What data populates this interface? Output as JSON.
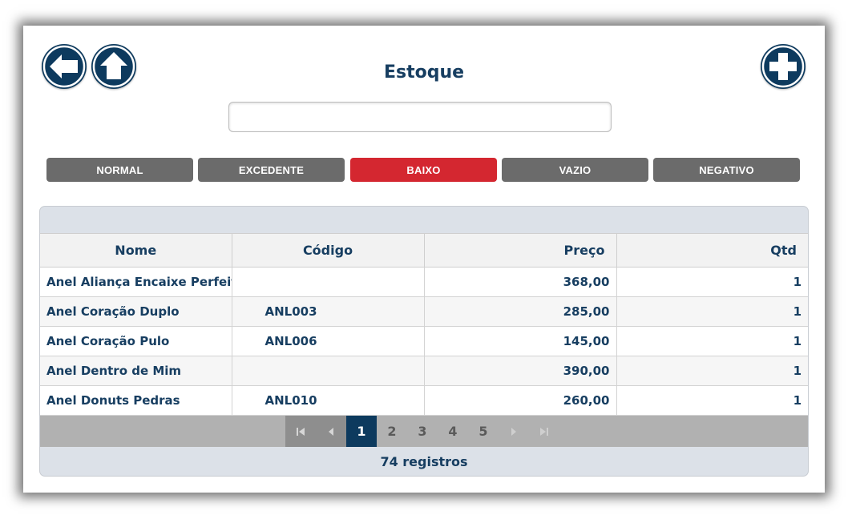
{
  "header": {
    "title": "Estoque",
    "back_icon": "arrow-left-icon",
    "home_icon": "arrow-up-icon",
    "add_icon": "plus-icon"
  },
  "search": {
    "value": "",
    "placeholder": ""
  },
  "filters": [
    {
      "label": "NORMAL",
      "active": false
    },
    {
      "label": "EXCEDENTE",
      "active": false
    },
    {
      "label": "BAIXO",
      "active": true
    },
    {
      "label": "VAZIO",
      "active": false
    },
    {
      "label": "NEGATIVO",
      "active": false
    }
  ],
  "table": {
    "columns": [
      "Nome",
      "Código",
      "Preço",
      "Qtd"
    ],
    "rows": [
      {
        "nome": "Anel Aliança Encaixe Perfeito",
        "codigo": "",
        "preco": "368,00",
        "qtd": "1"
      },
      {
        "nome": "Anel Coração Duplo",
        "codigo": "ANL003",
        "preco": "285,00",
        "qtd": "1"
      },
      {
        "nome": "Anel Coração Pulo",
        "codigo": "ANL006",
        "preco": "145,00",
        "qtd": "1"
      },
      {
        "nome": "Anel Dentro de Mim",
        "codigo": "",
        "preco": "390,00",
        "qtd": "1"
      },
      {
        "nome": "Anel Donuts Pedras",
        "codigo": "ANL010",
        "preco": "260,00",
        "qtd": "1"
      }
    ]
  },
  "pager": {
    "pages": [
      "1",
      "2",
      "3",
      "4",
      "5"
    ],
    "current_page": "1",
    "icons": [
      "first-page-icon",
      "prev-page-icon",
      "next-page-icon",
      "last-page-icon"
    ]
  },
  "footer": {
    "count": "74 registros"
  },
  "colors": {
    "brand": "#0d3a5e",
    "active_filter": "#d42730",
    "inactive_filter": "#6b6b6b",
    "text": "#173e61"
  }
}
